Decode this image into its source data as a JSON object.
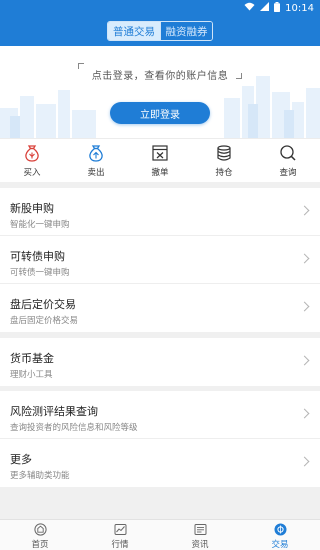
{
  "status_bar": {
    "time": "10:14",
    "icons": [
      "wifi-icon",
      "signal-icon",
      "battery-icon"
    ]
  },
  "header": {
    "tabs": [
      {
        "label": "普通交易",
        "active": true
      },
      {
        "label": "融资融券",
        "active": false
      }
    ]
  },
  "banner": {
    "hint": "点击登录，查看你的账户信息",
    "login_label": "立即登录"
  },
  "quick_actions": [
    {
      "label": "买入",
      "icon": "buy-moneybag-icon",
      "color": "#d9413a"
    },
    {
      "label": "卖出",
      "icon": "sell-moneybag-icon",
      "color": "#1f7dd6"
    },
    {
      "label": "撤单",
      "icon": "cancel-order-icon",
      "color": "#333333"
    },
    {
      "label": "持仓",
      "icon": "coins-stack-icon",
      "color": "#333333"
    },
    {
      "label": "查询",
      "icon": "search-icon",
      "color": "#333333"
    }
  ],
  "menu": {
    "ipo": {
      "title": "新股申购",
      "subtitle": "智能化一键申购"
    },
    "convertible": {
      "title": "可转债申购",
      "subtitle": "可转债一键申购"
    },
    "after_hours": {
      "title": "盘后定价交易",
      "subtitle": "盘后固定价格交易"
    },
    "money_fund": {
      "title": "货币基金",
      "subtitle": "理财小工具"
    },
    "risk": {
      "title": "风险测评结果查询",
      "subtitle": "查询投资者的风险信息和风险等级"
    },
    "more": {
      "title": "更多",
      "subtitle": "更多辅助类功能"
    }
  },
  "tab_bar": [
    {
      "label": "首页",
      "icon": "home-icon",
      "active": false
    },
    {
      "label": "行情",
      "icon": "market-icon",
      "active": false
    },
    {
      "label": "资讯",
      "icon": "news-icon",
      "active": false
    },
    {
      "label": "交易",
      "icon": "trade-icon",
      "active": true
    }
  ],
  "colors": {
    "brand": "#1f7dd6",
    "buy": "#d9413a",
    "background": "#f0f0f0"
  }
}
